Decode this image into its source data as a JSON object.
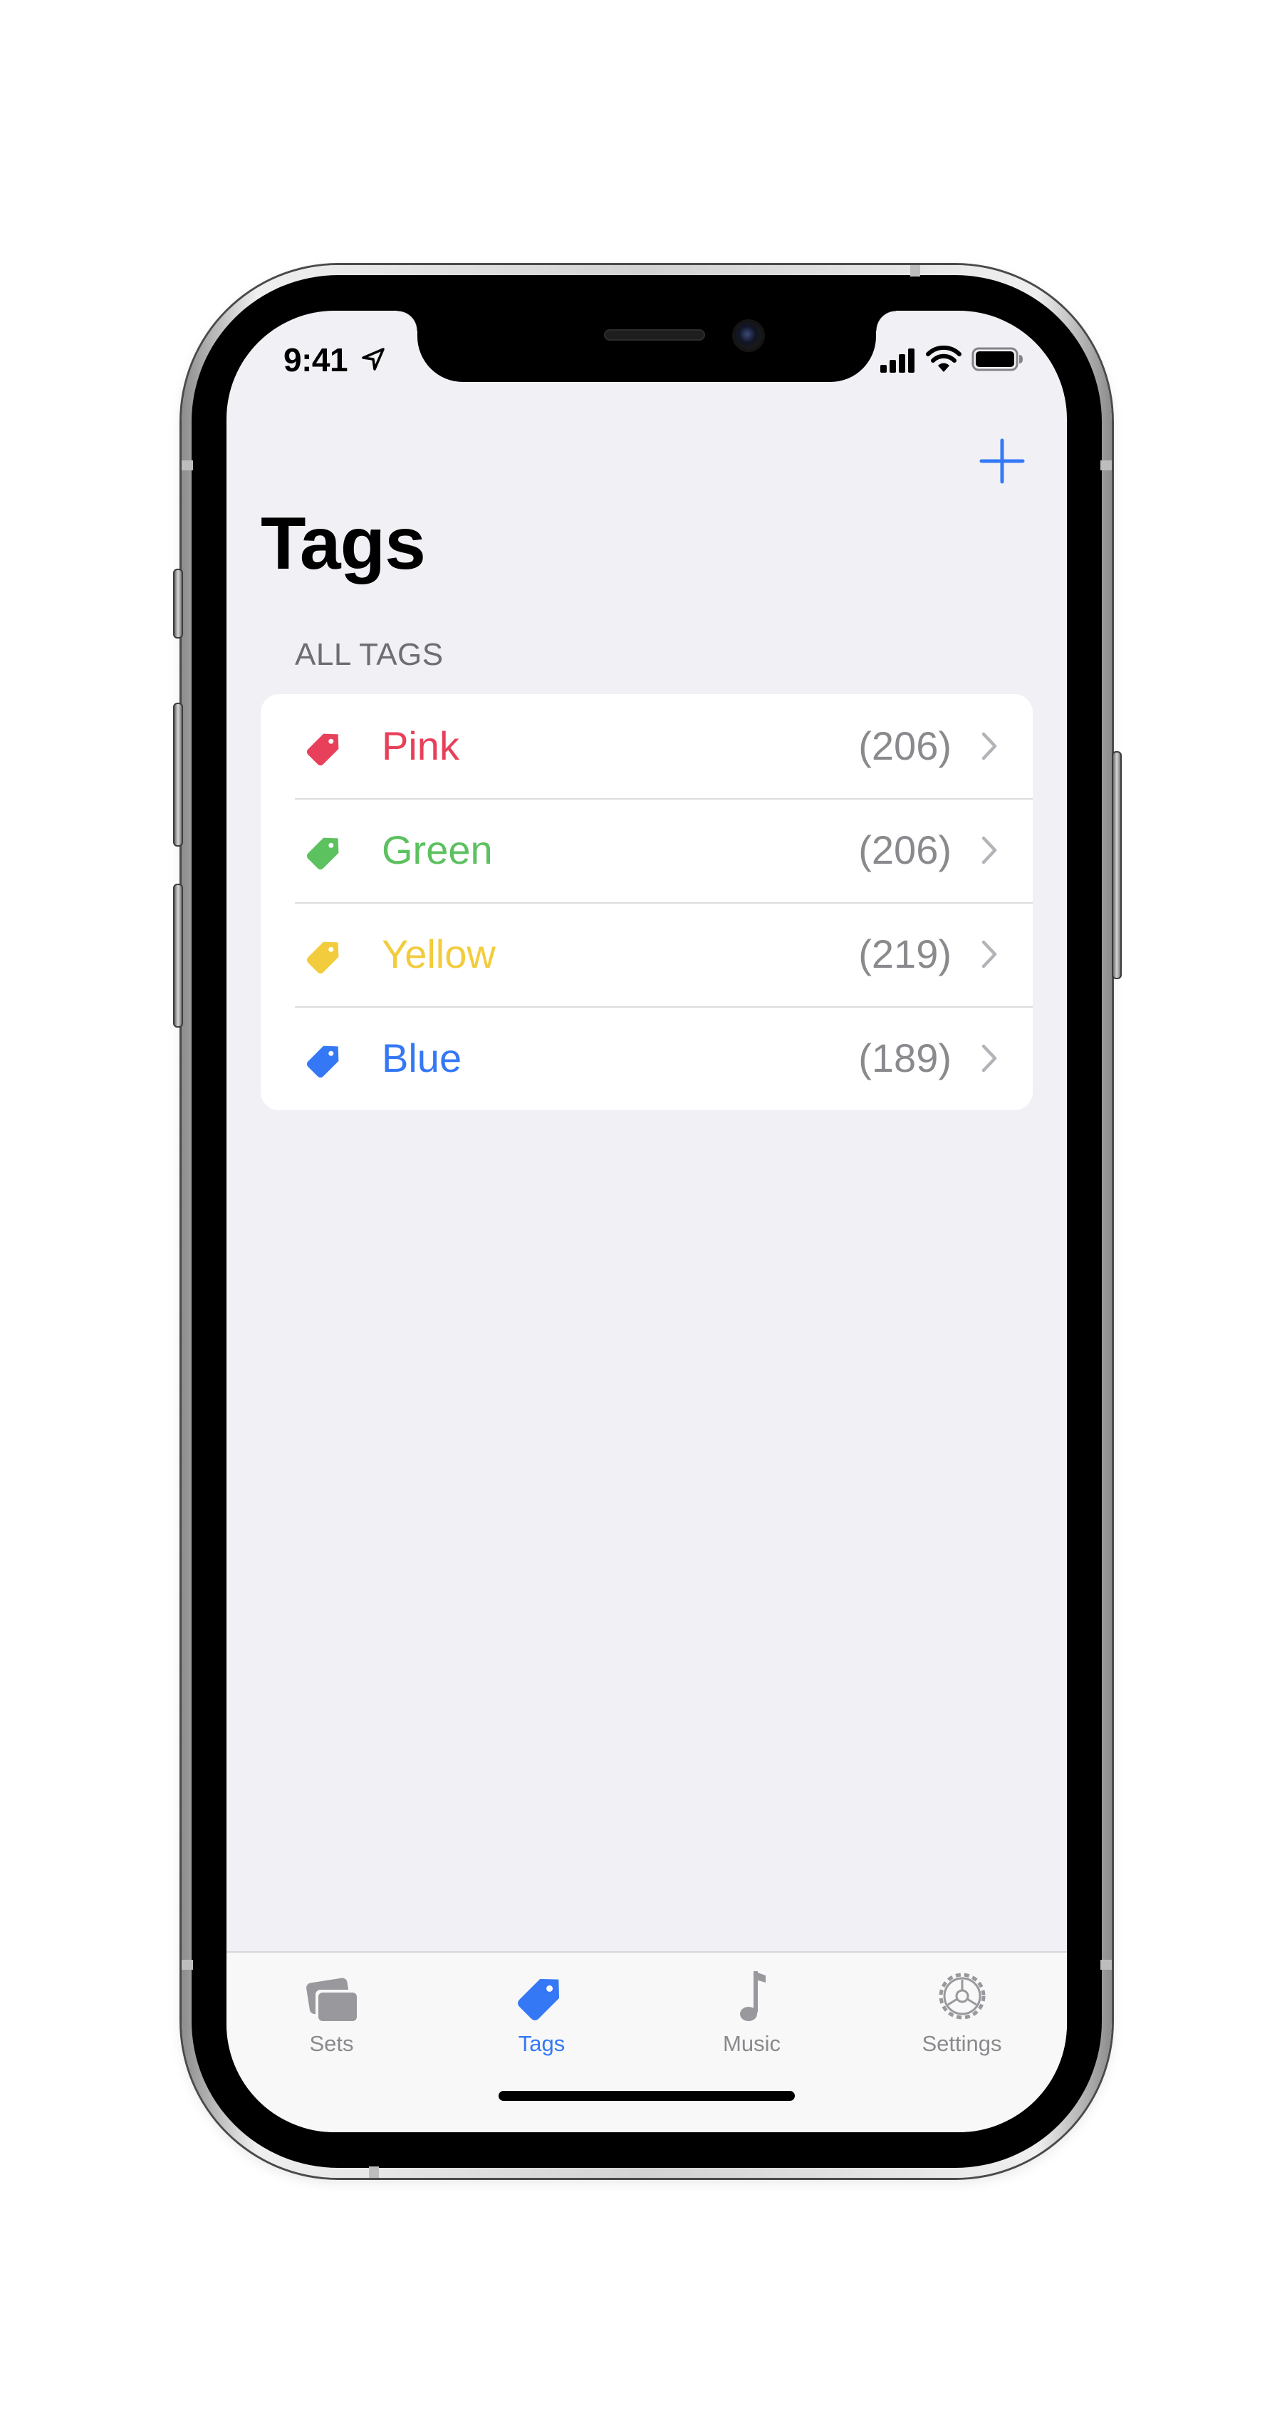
{
  "status_bar": {
    "time": "9:41",
    "icons": [
      "location-arrow-icon",
      "signal-bars-icon",
      "wifi-icon",
      "battery-icon"
    ]
  },
  "nav": {
    "add_icon": "plus-icon",
    "title": "Tags"
  },
  "section": {
    "header": "ALL TAGS"
  },
  "tags": [
    {
      "label": "Pink",
      "count": "(206)",
      "color": "#e8405a",
      "icon": "tag-icon"
    },
    {
      "label": "Green",
      "count": "(206)",
      "color": "#5cc15f",
      "icon": "tag-icon"
    },
    {
      "label": "Yellow",
      "count": "(219)",
      "color": "#f2cc3c",
      "icon": "tag-icon"
    },
    {
      "label": "Blue",
      "count": "(189)",
      "color": "#3478f6",
      "icon": "tag-icon"
    }
  ],
  "tabbar": {
    "tabs": [
      {
        "label": "Sets",
        "icon": "cards-icon",
        "active": false
      },
      {
        "label": "Tags",
        "icon": "tag-icon",
        "active": true
      },
      {
        "label": "Music",
        "icon": "music-note-icon",
        "active": false
      },
      {
        "label": "Settings",
        "icon": "gear-icon",
        "active": false
      }
    ]
  },
  "colors": {
    "accent": "#3478f6",
    "background": "#f0f0f5",
    "secondary_text": "#8a8a8e"
  }
}
